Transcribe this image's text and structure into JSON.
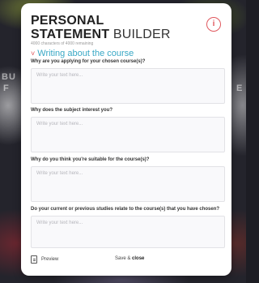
{
  "background": {
    "left_text": "BU",
    "left_text_2": "F",
    "right_text": "E"
  },
  "header": {
    "title_line1": "PERSONAL",
    "title_line2_bold": "STATEMENT",
    "title_line2_thin": "BUILDER",
    "counter": "4000 characters of 4000 remaining"
  },
  "info_button": {
    "icon": "info-icon",
    "glyph": "i",
    "color": "#e0585e"
  },
  "section": {
    "chevron": "˅",
    "title": "Writing about the course",
    "color": "#39a8c5"
  },
  "questions": [
    {
      "label": "Why are you applying for your chosen course(s)?",
      "placeholder": "Write your text here..."
    },
    {
      "label": "Why does the subject interest you?",
      "placeholder": "Write your text here..."
    },
    {
      "label": "Why do you think you're suitable for the course(s)?",
      "placeholder": "Write your text here..."
    },
    {
      "label": "Do your current or previous studies relate to the course(s) that you have chosen?",
      "placeholder": "Write your text here..."
    }
  ],
  "footer": {
    "preview_label": "Preview",
    "save_prefix": "Save &",
    "save_bold": "close"
  }
}
